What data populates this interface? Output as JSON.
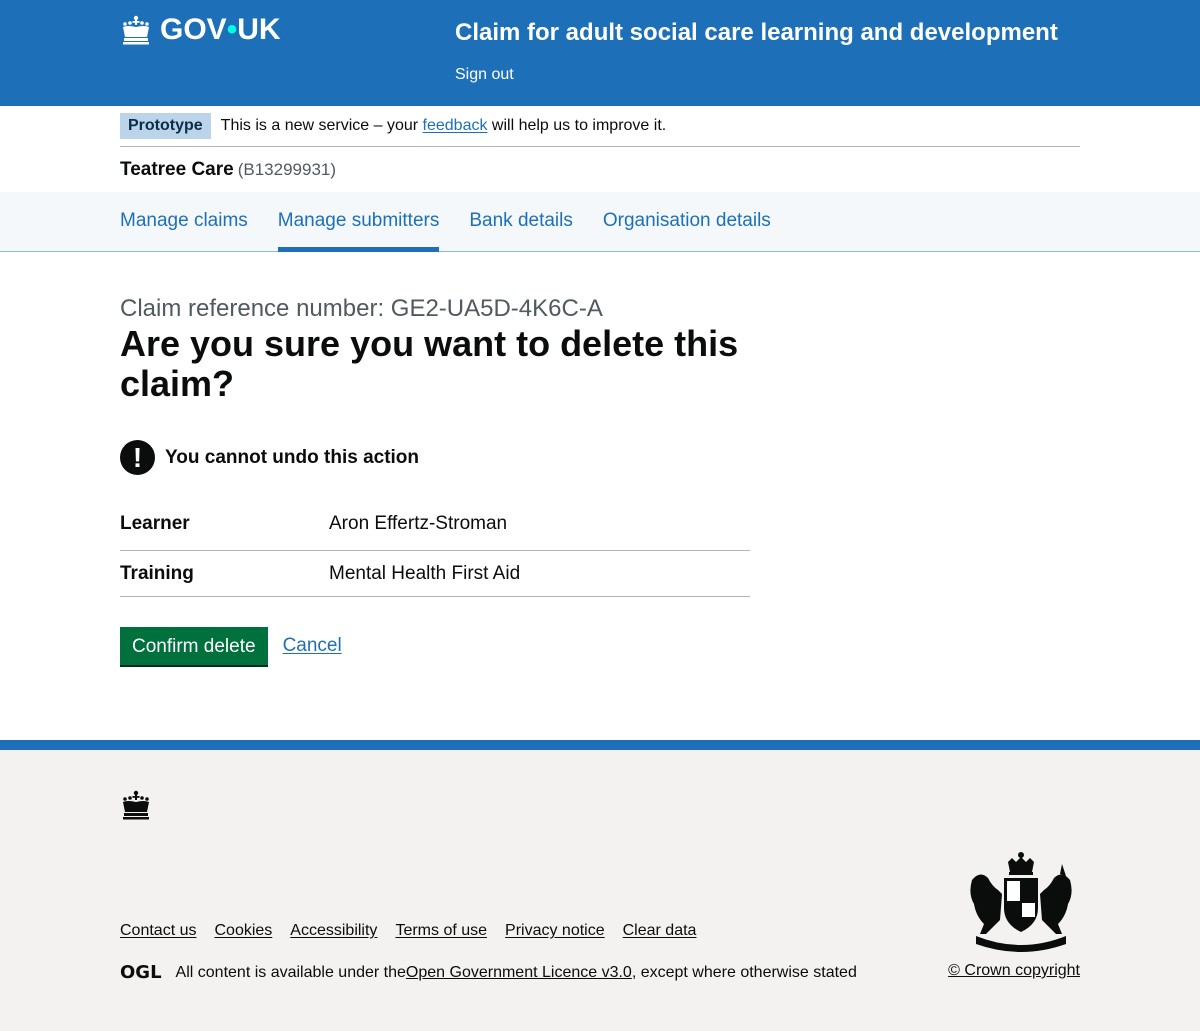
{
  "header": {
    "logo_text_1": "GOV",
    "logo_dot": "•",
    "logo_text_2": "UK",
    "service_name": "Claim for adult social care learning and development",
    "sign_out": "Sign out"
  },
  "phase_banner": {
    "tag": "Prototype",
    "text_before": "This is a new service – your ",
    "link": "feedback",
    "text_after": " will help us to improve it."
  },
  "organisation": {
    "name": "Teatree Care",
    "reference": "(B13299931)"
  },
  "subnav": {
    "items": [
      {
        "label": "Manage claims",
        "active": false
      },
      {
        "label": "Manage submitters",
        "active": true
      },
      {
        "label": "Bank details",
        "active": false
      },
      {
        "label": "Organisation details",
        "active": false
      }
    ]
  },
  "main": {
    "caption": "Claim reference number: GE2-UA5D-4K6C-A",
    "title": "Are you sure you want to delete this claim?",
    "warning_icon": "!",
    "warning_text": "You cannot undo this action",
    "summary": [
      {
        "key": "Learner",
        "value": "Aron Effertz-Stroman"
      },
      {
        "key": "Training",
        "value": "Mental Health First Aid"
      }
    ],
    "confirm_button": "Confirm delete",
    "cancel_link": "Cancel"
  },
  "footer": {
    "links": [
      "Contact us",
      "Cookies",
      "Accessibility",
      "Terms of use",
      "Privacy notice",
      "Clear data"
    ],
    "ogl": "OGL",
    "licence_before": "All content is available under the ",
    "licence_link": "Open Government Licence v3.0",
    "licence_after": ", except where otherwise stated",
    "copyright": "© Crown copyright"
  },
  "colors": {
    "brand_blue": "#1d70b8",
    "button_green": "#00703c",
    "tag_background": "#bbd4ea"
  }
}
